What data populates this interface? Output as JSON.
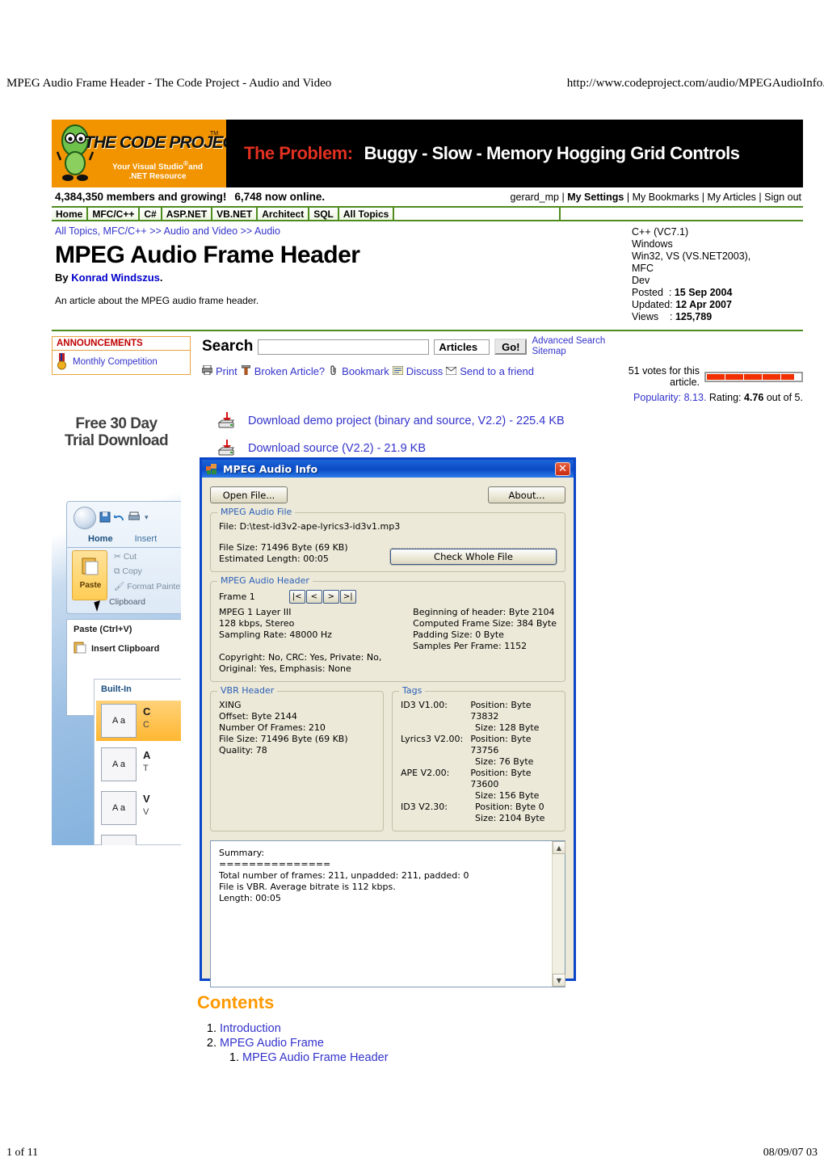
{
  "print": {
    "header_title": "MPEG Audio Frame Header - The Code Project - Audio and Video",
    "header_url": "http://www.codeproject.com/audio/MPEGAudioInfo.",
    "footer_page": "1 of 11",
    "footer_date": "08/09/07 03"
  },
  "brand": {
    "logo_text": "THE CODE PROJECT",
    "logo_tm": "TM",
    "logo_tagline": "Your Visual Studio® and\n.NET Resource",
    "ad_red": "The Problem:",
    "ad_white": "Buggy - Slow - Memory Hogging Grid Controls"
  },
  "members": {
    "count_text": "4,384,350 members and growing!",
    "online_text": "6,748 now online.",
    "user": "gerard_mp",
    "links": [
      "My Settings",
      "My Bookmarks",
      "My Articles",
      "Sign out"
    ]
  },
  "nav": {
    "tabs": [
      "Home",
      "MFC/C++",
      "C#",
      "ASP.NET",
      "VB.NET",
      "Architect",
      "SQL",
      "All Topics"
    ]
  },
  "breadcrumb": {
    "items": [
      "All Topics,",
      "MFC/C++",
      "Audio and Video",
      "Audio"
    ],
    "separator": ">>"
  },
  "article": {
    "title": "MPEG Audio Frame Header",
    "by_prefix": "By",
    "author": "Konrad Windszus",
    "by_suffix": ".",
    "abstract": "An article about the MPEG audio frame header."
  },
  "meta": {
    "lines": [
      "C++ (VC7.1)",
      "Windows",
      "Win32, VS (VS.NET2003),",
      "MFC",
      "Dev"
    ],
    "posted_label": "Posted",
    "posted_value": "15 Sep 2004",
    "updated_label": "Updated",
    "updated_value": "12 Apr 2007",
    "views_label": "Views",
    "views_value": "125,789"
  },
  "announcements": {
    "title": "ANNOUNCEMENTS",
    "items": [
      {
        "label": "Monthly Competition",
        "icon": "medal-icon"
      }
    ]
  },
  "search": {
    "label": "Search",
    "value": "",
    "placeholder": "",
    "scope": "Articles",
    "go_label": "Go!",
    "advanced_label": "Advanced Search",
    "sitemap_label": "Sitemap"
  },
  "tools": {
    "items": [
      {
        "label": "Print",
        "icon": "printer-icon"
      },
      {
        "label": "Broken Article?",
        "icon": "hammer-icon"
      },
      {
        "label": "Bookmark",
        "icon": "paperclip-icon"
      },
      {
        "label": "Discuss",
        "icon": "comment-icon"
      },
      {
        "label": "Send to a friend",
        "icon": "envelope-icon"
      }
    ]
  },
  "rating": {
    "votes_text": "51 votes for this article.",
    "bar_segments": 5,
    "bar_filled": 4.76,
    "bar_color": "#F03000",
    "popularity_label": "Popularity:",
    "popularity_value": "8.13",
    "rating_label": "Rating:",
    "rating_value": "4.76",
    "rating_suffix": "out of 5."
  },
  "sidebar_ad": {
    "headline": "Free 30 Day\nTrial Download",
    "ribbon_tabs": [
      "Home",
      "Insert"
    ],
    "clipboard_items": [
      "Cut",
      "Copy",
      "Format Painter"
    ],
    "paste_label": "Paste",
    "clipboard_group": "Clipboard",
    "tooltip_title": "Paste (Ctrl+V)",
    "tooltip_item": "Insert Clipboard",
    "gallery_header": "Built-In",
    "gallery_items": [
      {
        "swatch": "A a",
        "line1": "C",
        "line2": "C"
      },
      {
        "swatch": "A a",
        "line1": "A",
        "line2": "T"
      },
      {
        "swatch": "A a",
        "line1": "V",
        "line2": "V"
      }
    ]
  },
  "downloads": [
    {
      "label": "Download demo project (binary and source, V2.2) - 225.4 KB",
      "icon": "download-icon"
    },
    {
      "label": "Download source (V2.2) - 21.9 KB",
      "icon": "download-icon"
    }
  ],
  "dialog": {
    "title": "MPEG Audio Info",
    "close_label": "✕",
    "open_file_button": "Open File...",
    "about_button": "About...",
    "file_group": {
      "legend": "MPEG Audio File",
      "file_line": "File: D:\\test-id3v2-ape-lyrics3-id3v1.mp3",
      "size_line": "File Size: 71496 Byte (69 KB)\nEstimated Length: 00:05",
      "check_button": "Check Whole File"
    },
    "header_group": {
      "legend": "MPEG Audio Header",
      "frame_label": "Frame 1",
      "nav_buttons": [
        "|<",
        "<",
        ">",
        ">|"
      ],
      "left_lines": "MPEG 1 Layer III\n128 kbps, Stereo\nSampling Rate: 48000 Hz",
      "left_lines2": "Copyright: No, CRC: Yes, Private: No,\nOriginal: Yes, Emphasis: None",
      "right_lines": "Beginning of header: Byte 2104\nComputed Frame Size: 384 Byte\nPadding Size: 0 Byte\nSamples Per Frame: 1152"
    },
    "vbr_group": {
      "legend": "VBR Header",
      "lines": "XING\nOffset: Byte 2144\nNumber Of Frames: 210\nFile Size: 71496 Byte (69 KB)\nQuality: 78"
    },
    "tags_group": {
      "legend": "Tags",
      "rows": [
        {
          "name": "ID3 V1.00:",
          "position": "Position: Byte 73832",
          "size": "Size: 128 Byte"
        },
        {
          "name": "Lyrics3 V2.00:",
          "position": "Position: Byte 73756",
          "size": "Size: 76 Byte"
        },
        {
          "name": "APE V2.00:",
          "position": "Position: Byte 73600",
          "size": "Size: 156 Byte"
        },
        {
          "name": "ID3 V2.30:",
          "position": "Position: Byte 0",
          "size": "Size: 2104 Byte"
        }
      ]
    },
    "summary": "Summary:\n===============\nTotal number of frames: 211, unpadded: 211, padded: 0\nFile is VBR. Average bitrate is 112 kbps.\nLength: 00:05"
  },
  "contents": {
    "heading": "Contents",
    "items": [
      {
        "label": "Introduction"
      },
      {
        "label": "MPEG Audio Frame",
        "sub": [
          {
            "label": "MPEG Audio Frame Header"
          }
        ]
      }
    ]
  },
  "colors": {
    "nav_green": "#4E8C1E",
    "link_blue": "#3333CC",
    "brand_orange": "#F29300",
    "heading_orange": "#FF9900",
    "title_blue": "#0A46C8"
  }
}
